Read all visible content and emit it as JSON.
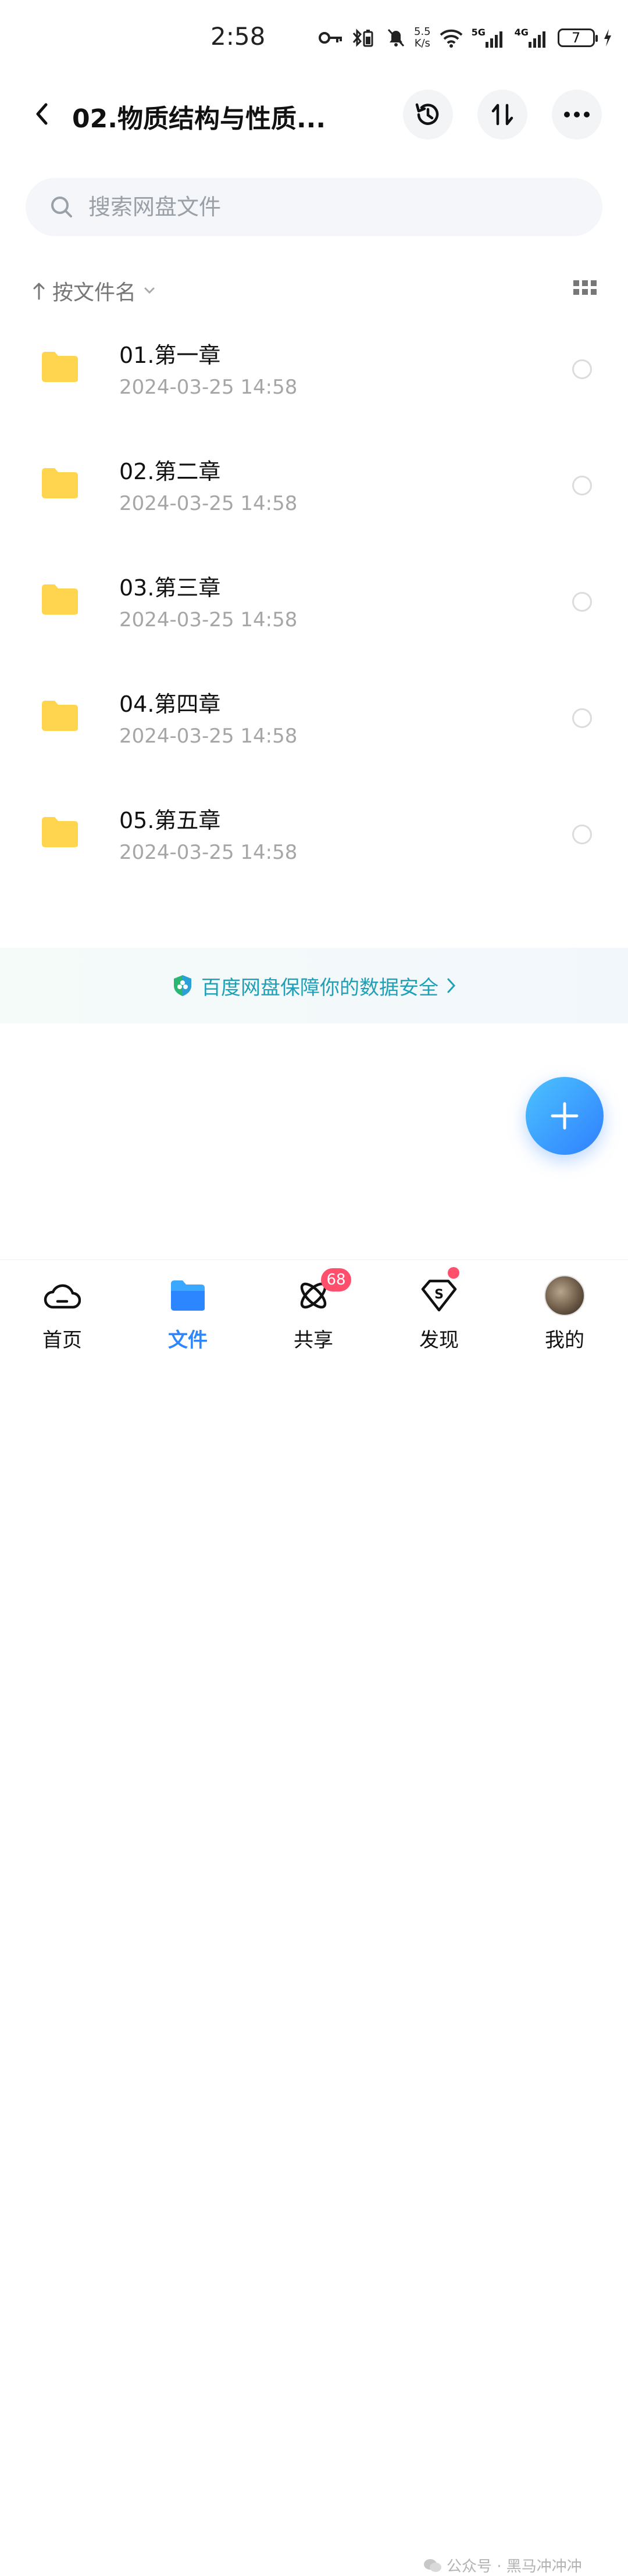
{
  "status_bar": {
    "time": "2:58",
    "net_speed_value": "5.5",
    "net_speed_unit": "K/s",
    "net1": "5G",
    "net2": "4G",
    "battery": "7"
  },
  "header": {
    "title": "02.物质结构与性质..."
  },
  "search": {
    "placeholder": "搜索网盘文件"
  },
  "sort": {
    "label": "按文件名"
  },
  "files": [
    {
      "name": "01.第一章",
      "date": "2024-03-25  14:58"
    },
    {
      "name": "02.第二章",
      "date": "2024-03-25  14:58"
    },
    {
      "name": "03.第三章",
      "date": "2024-03-25  14:58"
    },
    {
      "name": "04.第四章",
      "date": "2024-03-25  14:58"
    },
    {
      "name": "05.第五章",
      "date": "2024-03-25  14:58"
    }
  ],
  "banner": {
    "text": "百度网盘保障你的数据安全"
  },
  "bottom_nav": {
    "items": [
      {
        "label": "首页"
      },
      {
        "label": "文件"
      },
      {
        "label": "共享",
        "badge": "68"
      },
      {
        "label": "发现"
      },
      {
        "label": "我的"
      }
    ]
  },
  "watermark": {
    "text": "公众号 · 黑马冲冲冲"
  },
  "colors": {
    "accent": "#2b86ff",
    "folder": "#ffd54f",
    "badge": "#ff4f6d",
    "banner_text": "#1fa0b7"
  }
}
